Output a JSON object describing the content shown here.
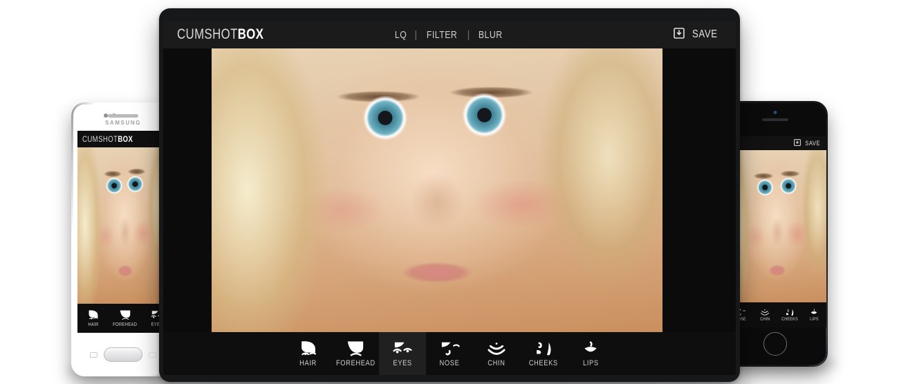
{
  "app": {
    "logo_thin": "CUMSHOT",
    "logo_bold": "BOX"
  },
  "tablet": {
    "menu": [
      {
        "label": "LQ"
      },
      {
        "label": "FILTER"
      },
      {
        "label": "BLUR"
      }
    ],
    "menu_separator": "|",
    "save_label": "SAVE",
    "save_icon": "save-download-icon",
    "toolbar": [
      {
        "label": "HAIR",
        "icon": "hair-icon",
        "active": false
      },
      {
        "label": "FOREHEAD",
        "icon": "forehead-icon",
        "active": false
      },
      {
        "label": "EYES",
        "icon": "eyes-icon",
        "active": true
      },
      {
        "label": "NOSE",
        "icon": "nose-icon",
        "active": false
      },
      {
        "label": "CHIN",
        "icon": "chin-icon",
        "active": false
      },
      {
        "label": "CHEEKS",
        "icon": "cheeks-icon",
        "active": false
      },
      {
        "label": "LIPS",
        "icon": "lips-icon",
        "active": false
      }
    ]
  },
  "samsung": {
    "brand": "SAMSUNG",
    "toolbar": [
      {
        "label": "HAIR",
        "icon": "hair-icon"
      },
      {
        "label": "FOREHEAD",
        "icon": "forehead-icon"
      },
      {
        "label": "EYES",
        "icon": "eyes-icon"
      }
    ]
  },
  "iphone": {
    "save_label": "SAVE",
    "save_icon": "save-download-icon",
    "toolbar": [
      {
        "label": "NOSE",
        "icon": "nose-icon"
      },
      {
        "label": "CHIN",
        "icon": "chin-icon"
      },
      {
        "label": "CHEEKS",
        "icon": "cheeks-icon"
      },
      {
        "label": "LIPS",
        "icon": "lips-icon"
      }
    ]
  },
  "colors": {
    "header_bg": "#1b1b1b",
    "toolbar_bg": "#0e0e0e",
    "toolbar_active_bg": "#202020",
    "text": "#e2e2e2",
    "canvas_bg": "#0b0b0b"
  }
}
